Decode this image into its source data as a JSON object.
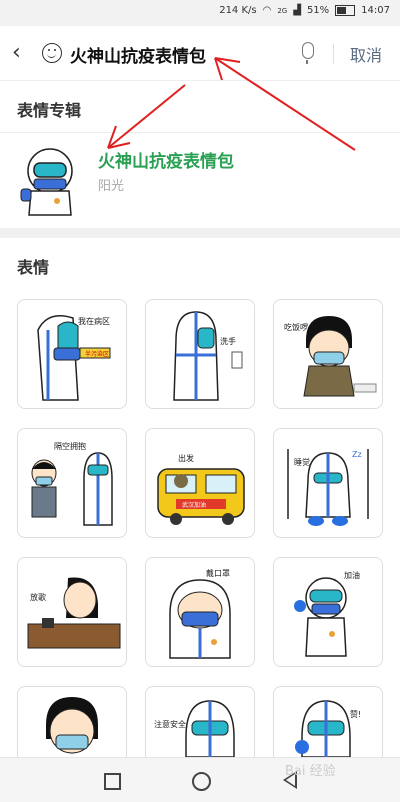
{
  "status_bar": {
    "network": "214 K/s",
    "signal": "2G",
    "battery": "51%",
    "time": "14:07"
  },
  "search": {
    "query": "火神山抗疫表情包",
    "cancel_label": "取消"
  },
  "sections": {
    "albums_title": "表情专辑",
    "stickers_title": "表情"
  },
  "album": {
    "name": "火神山抗疫表情包",
    "author": "阳光"
  },
  "stickers": [
    {
      "caption": "我在病区",
      "tag": "半污染区"
    },
    {
      "caption": "洗手"
    },
    {
      "caption": "吃饭啰"
    },
    {
      "caption": "隔空拥抱"
    },
    {
      "caption": "出发",
      "tag": "武汉加油"
    },
    {
      "caption": "睡觉"
    },
    {
      "caption": "放歌"
    },
    {
      "caption": "戴口罩"
    },
    {
      "caption": "加油"
    },
    {
      "caption": ""
    },
    {
      "caption": "注意安全"
    },
    {
      "caption": "赞!"
    }
  ],
  "watermark": "Bai 经验",
  "colors": {
    "album_name": "#2aa053",
    "cancel": "#5a6a80",
    "arrow": "#e02020"
  }
}
